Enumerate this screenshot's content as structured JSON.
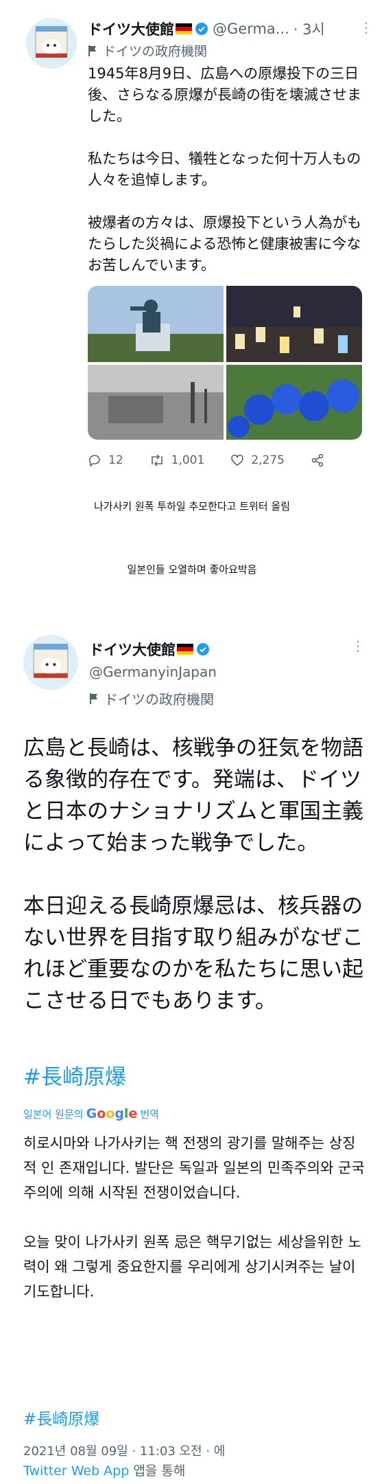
{
  "tweet1": {
    "name": "ドイツ大使館",
    "handle": "@Germa...",
    "time": "· 3시",
    "gov_label": "ドイツの政府機関",
    "body": [
      "1945年8月9日、広島への原爆投下の三日後、さらなる原爆が長崎の街を壊滅させました。",
      "私たちは今日、犠牲となった何十万人もの人々を追悼します。",
      "被爆者の方々は、原爆投下という人為がもたらした災禍による恐怖と健康被害に今なお苦しんでいます。"
    ],
    "replies": "12",
    "retweets": "1,001",
    "likes": "2,275"
  },
  "caption1": "나가사키 원폭 투하일  추모한다고 트위터 올림",
  "caption2": "일본인들 오열하며 좋아요박음",
  "tweet2": {
    "name": "ドイツ大使館",
    "handle": "@GermanyinJapan",
    "gov_label": "ドイツの政府機関",
    "body": [
      "広島と長崎は、核戦争の狂気を物語る象徴的存在です。発端は、ドイツと日本のナショナリズムと軍国主義によって始まった戦争でした。",
      "本日迎える長崎原爆忌は、核兵器のない世界を目指す取り組みがなぜこれほど重要なのかを私たちに思い起こさせる日でもあります。"
    ],
    "hashtag": "#長崎原爆",
    "translation_prefix": "일본어 원문의",
    "translation_google": "Google",
    "translation_suffix": "번역",
    "translation": [
      "히로시마와 나가사키는 핵 전쟁의 광기를 말해주는 상징적 인 존재입니다. 발단은 독일과 일본의 민족주의와 군국주의에 의해 시작된 전쟁이었습니다.",
      "오늘 맞이 나가사키 원폭 忌은 핵무기없는 세상을위한 노력이 왜 그렇게 중요한지를 우리에게 상기시켜주는 날이기도합니다."
    ],
    "hashtag_translated": "#長崎原爆",
    "date": "2021년 08월 09일 · 11:03 오전 · 에",
    "app_name": "Twitter Web App",
    "app_suffix": "앱을 통해"
  },
  "colors": {
    "link": "#1d9bf0",
    "muted": "#536471",
    "verified": "#1d9bf0"
  }
}
